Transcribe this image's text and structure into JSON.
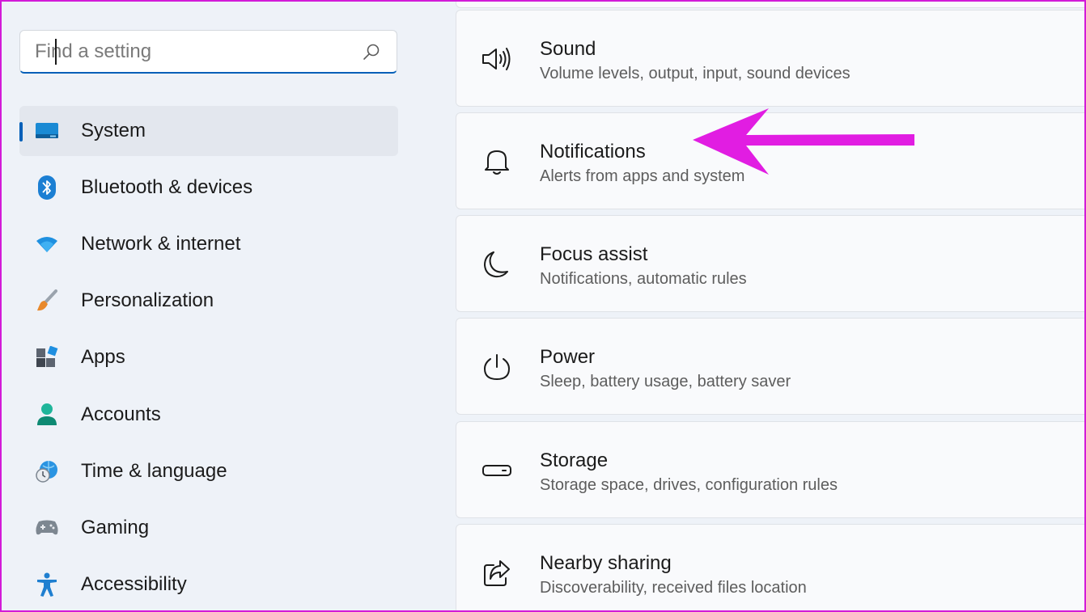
{
  "search": {
    "placeholder": "Find a setting"
  },
  "sidebar": {
    "items": [
      {
        "label": "System",
        "icon": "monitor-icon",
        "selected": true
      },
      {
        "label": "Bluetooth & devices",
        "icon": "bluetooth-icon"
      },
      {
        "label": "Network & internet",
        "icon": "wifi-icon"
      },
      {
        "label": "Personalization",
        "icon": "brush-icon"
      },
      {
        "label": "Apps",
        "icon": "apps-icon"
      },
      {
        "label": "Accounts",
        "icon": "person-icon"
      },
      {
        "label": "Time & language",
        "icon": "globe-clock-icon"
      },
      {
        "label": "Gaming",
        "icon": "gamepad-icon"
      },
      {
        "label": "Accessibility",
        "icon": "accessibility-icon"
      }
    ]
  },
  "main": {
    "cards": [
      {
        "title": "Sound",
        "subtitle": "Volume levels, output, input, sound devices",
        "icon": "speaker-icon"
      },
      {
        "title": "Notifications",
        "subtitle": "Alerts from apps and system",
        "icon": "bell-icon"
      },
      {
        "title": "Focus assist",
        "subtitle": "Notifications, automatic rules",
        "icon": "moon-icon"
      },
      {
        "title": "Power",
        "subtitle": "Sleep, battery usage, battery saver",
        "icon": "power-icon"
      },
      {
        "title": "Storage",
        "subtitle": "Storage space, drives, configuration rules",
        "icon": "storage-drive-icon"
      },
      {
        "title": "Nearby sharing",
        "subtitle": "Discoverability, received files location",
        "icon": "share-icon"
      }
    ]
  },
  "annotation": {
    "arrow_color": "#e11de2"
  },
  "colors": {
    "accent": "#005fb8",
    "frame": "#d21bd8"
  }
}
